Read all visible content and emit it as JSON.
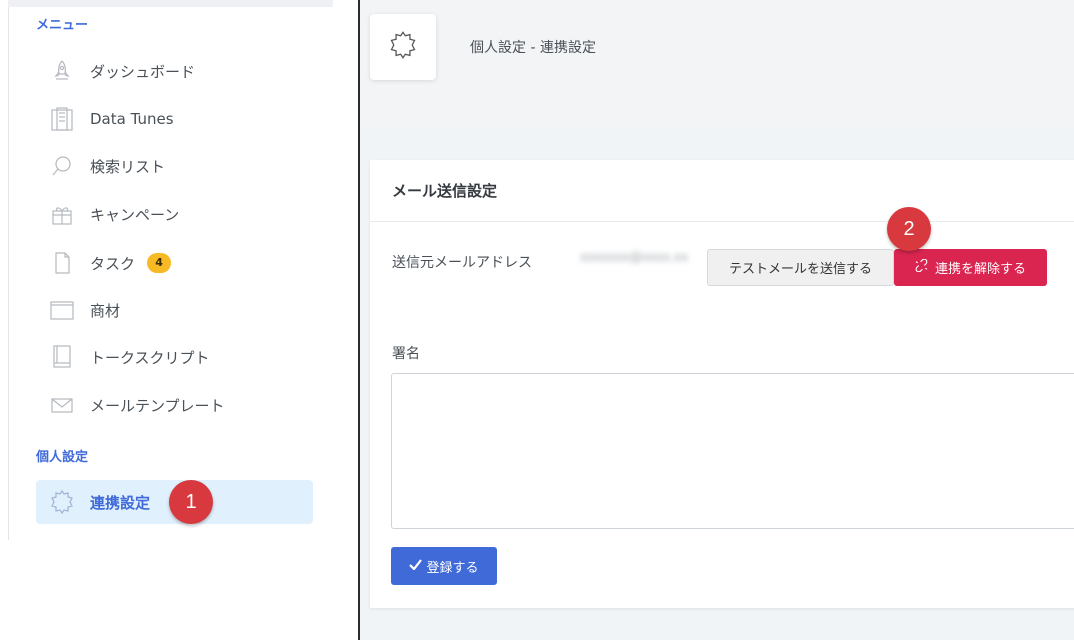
{
  "sidebar": {
    "menu_heading": "メニュー",
    "personal_heading": "個人設定",
    "items": [
      {
        "label": "ダッシュボード",
        "icon": "rocket-icon"
      },
      {
        "label": "Data Tunes",
        "icon": "building-icon"
      },
      {
        "label": "検索リスト",
        "icon": "search-icon"
      },
      {
        "label": "キャンペーン",
        "icon": "gift-icon"
      },
      {
        "label": "タスク",
        "icon": "document-icon",
        "badge": "4"
      },
      {
        "label": "商材",
        "icon": "box-icon"
      },
      {
        "label": "トークスクリプト",
        "icon": "book-icon"
      },
      {
        "label": "メールテンプレート",
        "icon": "mail-icon"
      }
    ],
    "active_item": {
      "label": "連携設定",
      "icon": "gear-icon"
    }
  },
  "header": {
    "title": "個人設定 - 連携設定",
    "icon": "gear-icon"
  },
  "card": {
    "title": "メール送信設定",
    "sender_label": "送信元メールアドレス",
    "sender_value": "xxxxxxx@xxxx.xx",
    "test_button": "テストメールを送信する",
    "unlink_button": "連携を解除する",
    "signature_label": "署名",
    "signature_value": "",
    "submit_button": "登録する"
  },
  "markers": [
    "1",
    "2"
  ],
  "colors": {
    "accent": "#3f6ad8",
    "danger": "#d92550",
    "badge": "#f7b924",
    "marker": "#d7393e",
    "active_bg": "#e0f0fd"
  }
}
